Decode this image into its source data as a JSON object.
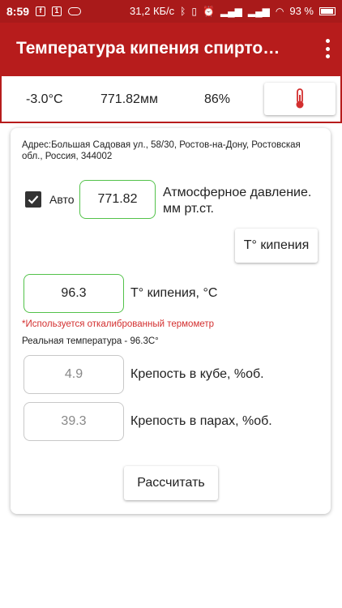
{
  "status_bar": {
    "time": "8:59",
    "speed": "31,2 КБ/с",
    "battery": "93 %"
  },
  "app_bar": {
    "title": "Температура кипения спирто…"
  },
  "info_bar": {
    "temperature": "-3.0°C",
    "pressure": "771.82мм",
    "humidity": "86%"
  },
  "card": {
    "address": "Адрес:Большая Садовая ул., 58/30, Ростов-на-Дону, Ростовская обл., Россия, 344002",
    "auto_label": "Авто",
    "auto_checked": true,
    "pressure_value": "771.82",
    "pressure_label": "Атмосферное давление. мм рт.ст.",
    "boil_button": "T° кипения",
    "boil_value": "96.3",
    "boil_label": "T° кипения, °C",
    "warning": "*Используется откалиброванный термометр",
    "real_temp": "Реальная температура - 96.3С°",
    "cube_value": "4.9",
    "cube_label": "Крепость в кубе, %об.",
    "vapor_value": "39.3",
    "vapor_label": "Крепость в парах, %об.",
    "calc_button": "Рассчитать"
  },
  "colors": {
    "primary": "#b71c1c",
    "status_bar": "#a91a1a",
    "accent_green": "#53c24a",
    "warning_red": "#d32f2f"
  },
  "icons": {
    "thermometer": "thermometer-icon",
    "overflow": "more-vert-icon"
  }
}
